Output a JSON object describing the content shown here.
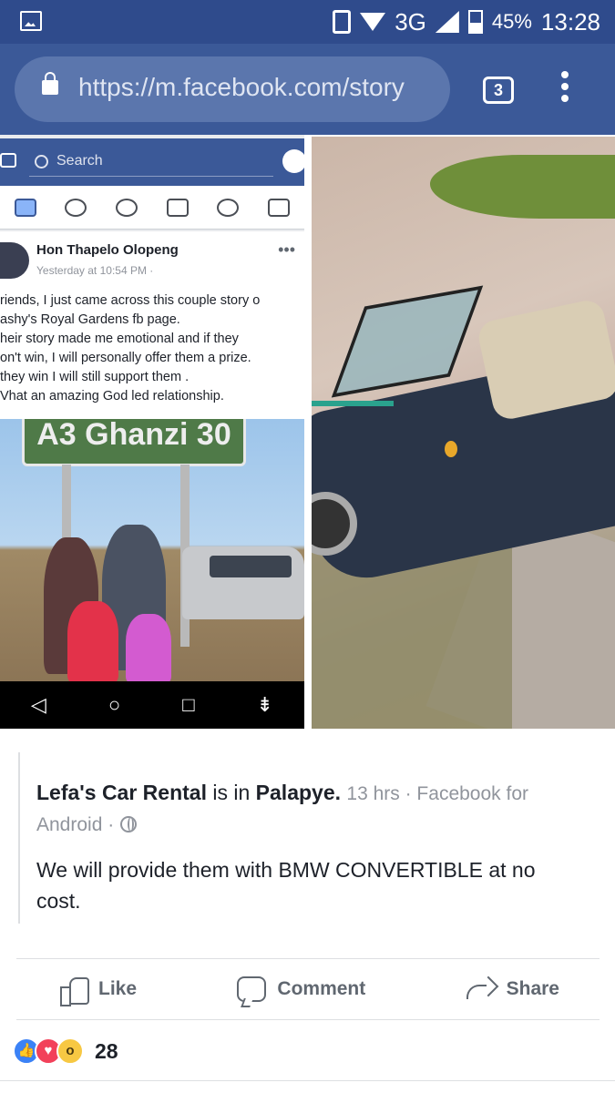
{
  "status_bar": {
    "network": "3G",
    "battery": "45%",
    "time": "13:28"
  },
  "browser": {
    "url": "https://m.facebook.com/story",
    "tab_count": "3"
  },
  "embedded_screenshot": {
    "search_placeholder": "Search",
    "post_author": "Hon Thapelo Olopeng",
    "post_time": "Yesterday at 10:54 PM ·",
    "post_lines": [
      "riends, I just came across this couple story o",
      "ashy's Royal Gardens fb page.",
      "heir story made me emotional and if they",
      "on't win, I will personally offer them a prize.",
      " they win I will still support them  .",
      "Vhat an amazing God led relationship."
    ],
    "sign_text": "A3 Ghanzi 30",
    "nav_buttons": [
      "◁",
      "○",
      "□",
      "⇟"
    ]
  },
  "shared_post": {
    "page_name": "Lefa's Car Rental",
    "is_in": "is in",
    "location": "Palapye",
    "meta": "13 hrs · Facebook for Android ·",
    "text": "We will provide them with BMW CONVERTIBLE at no cost."
  },
  "actions": {
    "like": "Like",
    "comment": "Comment",
    "share": "Share"
  },
  "reactions": {
    "icons": [
      "like-icon",
      "love-icon",
      "wow-icon"
    ],
    "count": "28"
  },
  "colors": {
    "status_bar": "#2f4b8c",
    "url_bar": "#3b5998",
    "facebook_blue": "#3b5998"
  }
}
